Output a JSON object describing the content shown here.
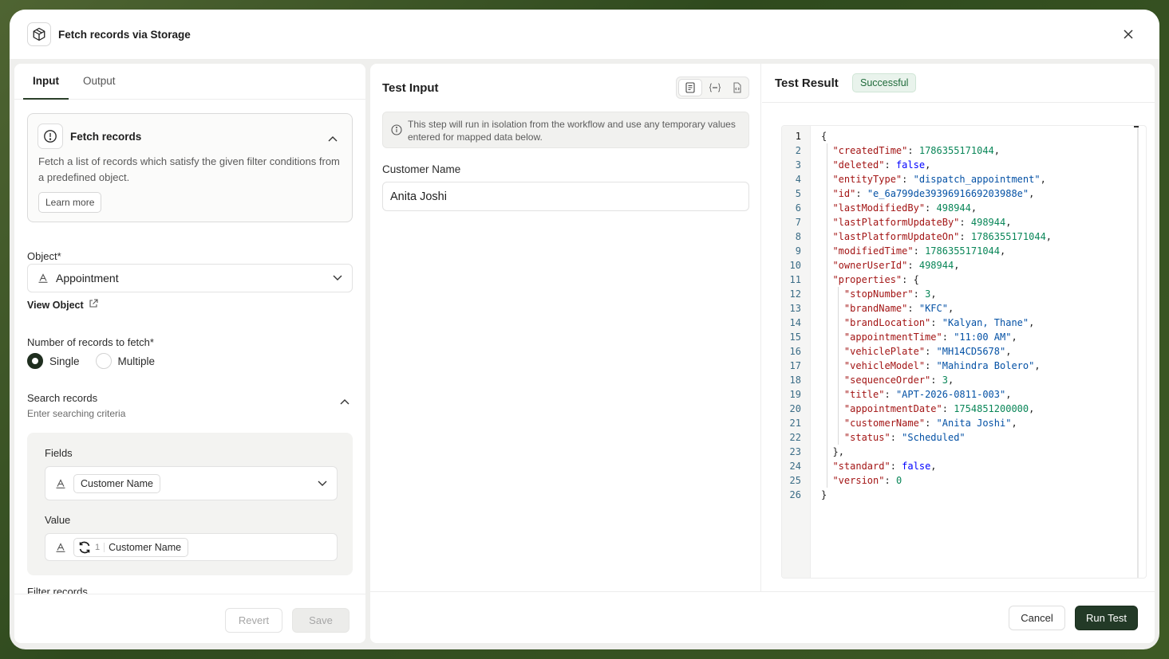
{
  "header": {
    "title": "Fetch records via Storage"
  },
  "tabs": [
    {
      "label": "Input"
    },
    {
      "label": "Output"
    }
  ],
  "info_card": {
    "title": "Fetch records",
    "description": "Fetch a list of records which satisfy the given filter conditions from a predefined object.",
    "learn_more": "Learn more"
  },
  "object": {
    "label": "Object*",
    "value": "Appointment",
    "view_link": "View Object"
  },
  "record_count": {
    "label": "Number of records to fetch*",
    "options": [
      "Single",
      "Multiple"
    ],
    "selected": "Single"
  },
  "search": {
    "title": "Search records",
    "subtitle": "Enter searching criteria",
    "fields_label": "Fields",
    "field_value": "Customer Name",
    "value_label": "Value",
    "value_step": "1",
    "value_chip": "Customer Name"
  },
  "filter_label": "Filter records",
  "left_footer": {
    "revert": "Revert",
    "save": "Save"
  },
  "test_input": {
    "title": "Test Input",
    "notice": "This step will run in isolation from the workflow and use any temporary values entered for mapped data below.",
    "field_label": "Customer Name",
    "field_value": "Anita Joshi"
  },
  "test_result": {
    "title": "Test Result",
    "status": "Successful",
    "lines": [
      "{",
      "  \"createdTime\": 1786355171044,",
      "  \"deleted\": false,",
      "  \"entityType\": \"dispatch_appointment\",",
      "  \"id\": \"e_6a799de3939691669203988e\",",
      "  \"lastModifiedBy\": 498944,",
      "  \"lastPlatformUpdateBy\": 498944,",
      "  \"lastPlatformUpdateOn\": 1786355171044,",
      "  \"modifiedTime\": 1786355171044,",
      "  \"ownerUserId\": 498944,",
      "  \"properties\": {",
      "    \"stopNumber\": 3,",
      "    \"brandName\": \"KFC\",",
      "    \"brandLocation\": \"Kalyan, Thane\",",
      "    \"appointmentTime\": \"11:00 AM\",",
      "    \"vehiclePlate\": \"MH14CD5678\",",
      "    \"vehicleModel\": \"Mahindra Bolero\",",
      "    \"sequenceOrder\": 3,",
      "    \"title\": \"APT-2026-0811-003\",",
      "    \"appointmentDate\": 1754851200000,",
      "    \"customerName\": \"Anita Joshi\",",
      "    \"status\": \"Scheduled\"",
      "  },",
      "  \"standard\": false,",
      "  \"version\": 0",
      "}"
    ]
  },
  "right_footer": {
    "cancel": "Cancel",
    "run": "Run Test"
  },
  "colors": {
    "primary": "#233a27",
    "success_bg": "#e9f3ec",
    "success_text": "#1f6b3a"
  },
  "icons": {
    "header": "package-icon",
    "close": "close-icon",
    "info": "alert-circle-icon",
    "type": "text-type-icon",
    "external": "external-link-icon",
    "mapping": "refresh-icon"
  }
}
